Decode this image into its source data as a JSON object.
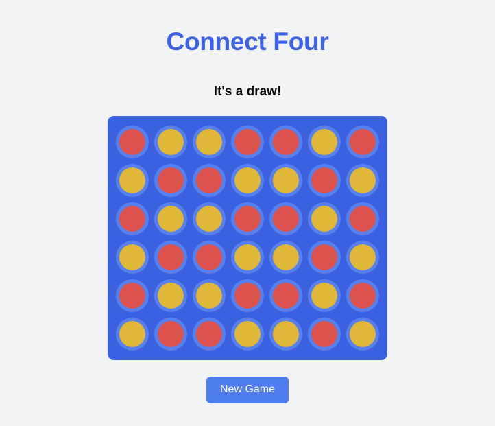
{
  "page": {
    "title": "Connect Four",
    "background_color": "#f2f3f5"
  },
  "status": {
    "message": "It's a draw!"
  },
  "controls": {
    "new_game_label": "New Game"
  },
  "board": {
    "rows": 6,
    "columns": 7,
    "board_color": "#3a62e0",
    "cell_hole_color": "#5580ee",
    "player_colors": {
      "red": "#dc534e",
      "yellow": "#e1b73a"
    },
    "grid": [
      [
        "red",
        "yellow",
        "yellow",
        "red",
        "red",
        "yellow",
        "red"
      ],
      [
        "yellow",
        "red",
        "red",
        "yellow",
        "yellow",
        "red",
        "yellow"
      ],
      [
        "red",
        "yellow",
        "yellow",
        "red",
        "red",
        "yellow",
        "red"
      ],
      [
        "yellow",
        "red",
        "red",
        "yellow",
        "yellow",
        "red",
        "yellow"
      ],
      [
        "red",
        "yellow",
        "yellow",
        "red",
        "red",
        "yellow",
        "red"
      ],
      [
        "yellow",
        "red",
        "red",
        "yellow",
        "yellow",
        "red",
        "yellow"
      ]
    ]
  },
  "theme": {
    "title_color": "#3c62e8",
    "button_color": "#4f7df0",
    "status_color": "#0b0b0d"
  }
}
